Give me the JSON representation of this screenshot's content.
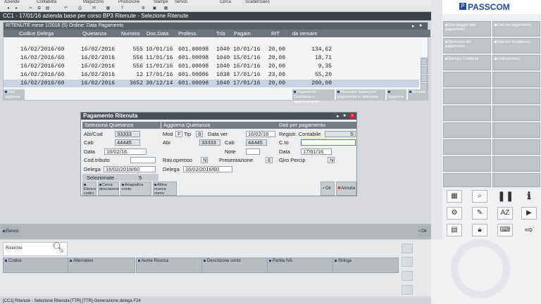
{
  "menu": {
    "items": [
      "Aziende",
      "Contabilità",
      "Magazzino",
      "Produzione",
      "Stampe",
      "Servizi",
      "Cerca",
      "Scadenziario"
    ]
  },
  "window": {
    "title": "CC1 - 17/01/16 azienda base per corso BP3  Ritenute - Selezione Ritenute"
  },
  "list": {
    "header": "RITENUTE  mese 1/2016 (5)  Ordine: Data Pagamento",
    "columns": [
      "Codice Delega",
      "Quietanza",
      "Numero",
      "Doc.Data",
      "Profess.",
      "Trib",
      "Pagam.",
      "RIT",
      "da versare"
    ],
    "rows": [
      {
        "codice": "16/02/2016/60",
        "quietanza": "16/02/2016",
        "numero": "555",
        "docdata": "10/01/16",
        "profess": "601.00098",
        "trib": "1040",
        "pagam": "10/01/16",
        "rit": "20,00",
        "versare": "134,62"
      },
      {
        "codice": "16/02/2016/60",
        "quietanza": "16/02/2016",
        "numero": "556",
        "docdata": "11/01/16",
        "profess": "601.00098",
        "trib": "1040",
        "pagam": "15/01/16",
        "rit": "20,00",
        "versare": "18,71"
      },
      {
        "codice": "16/02/2016/60",
        "quietanza": "16/02/2016",
        "numero": "556",
        "docdata": "11/01/16",
        "profess": "601.00098",
        "trib": "1040",
        "pagam": "16/01/16",
        "rit": "20,00",
        "versare": "9,35"
      },
      {
        "codice": "16/02/2016/60",
        "quietanza": "16/02/2016",
        "numero": "12",
        "docdata": "17/01/16",
        "profess": "601.00086",
        "trib": "1038",
        "pagam": "17/01/16",
        "rit": "23,00",
        "versare": "55,20"
      },
      {
        "codice": "16/02/2016/60",
        "quietanza": "16/02/2016",
        "numero": "3652",
        "docdata": "30/12/14",
        "profess": "601.00098",
        "trib": "1040",
        "pagam": "17/01/16",
        "rit": "20,00",
        "versare": "200,00"
      }
    ],
    "buttons": {
      "esci": "Esci aggiorna",
      "pagamento": "Pagamento Quietanza e aggiornamento",
      "revisione": "Revisione operazioni pagamento in selezione",
      "aggiorna": "Aggiorna",
      "annulla": "Annulla"
    }
  },
  "dialog": {
    "title": "Pagamento Ritenuta",
    "sel_header": "Seleziona Quietanza",
    "agg_header": "Aggiorna Quietanza",
    "dati_header": "Dati per pagamento",
    "abicod_label": "Abi/Cod",
    "abicod_value": "33333",
    "cab_label": "Cab",
    "cab_value": "44445",
    "data_label": "Data",
    "data_value": "16/02/16",
    "codtributo_label": "Cod.tributo",
    "delega_label": "Delega",
    "delega_value": "16/02/2016/60",
    "selezionate_label": "Selezionate",
    "selezionate_value": "5",
    "mod_label": "Mod",
    "mod_value": "F",
    "tip_label": "Tip",
    "tip_value": "B",
    "dataver_label": "Data ver",
    "dataver_value": "16/02/16",
    "abi2_label": "Abi",
    "abi2_value": "33333",
    "cab2_label": "Cab",
    "cab2_value": "44445",
    "note_label": "Note",
    "ravoperoso_label": "Rav.operoso",
    "ravoperoso_value": "N",
    "presentazione_label": "Presentazione",
    "presentazione_value": "E",
    "delega2_label": "Delega",
    "delega2_value": "16/02/2016/60",
    "registr_label": "Registr. Contabile",
    "registr_value": "S",
    "cto_label": "C.to",
    "data3_label": "Data",
    "data3_value": "17/01/16",
    "giroperc_label": "Giro Percip",
    "giroperc_value": "N",
    "btn_elenco": "Elenco codici",
    "btn_cerca": "Cerca descrizione",
    "btn_anagrafica": "Anagrafica conto",
    "btn_attiva": "Attiva ricerca menu",
    "btn_ok": "Ok",
    "btn_annulla": "Annulla"
  },
  "bottom": {
    "elenco": "Elenco",
    "ok": "Ok",
    "ricerche": "Ricerche",
    "buttons": [
      "Codice",
      "Alternativo",
      "Nome Ricerca",
      "Descrizione conto",
      "Partita IVA",
      "Stringa"
    ]
  },
  "status": {
    "left": "[CC1] Ritenute - Selezione Ritenute",
    "right": "[TTR] [TTR]-Generazione delega F24"
  },
  "right": {
    "logo": "PASSCOM",
    "buttons": [
      "Salvataggio dati pagamento",
      "Dati del pagamento",
      "Storicizza del pagamento",
      "Stampa brogliaccio",
      "Stampa Certificati",
      "Ordinamento"
    ]
  },
  "colors": {
    "accent": "#1f4b9a",
    "titlebar": "#3d4249",
    "header": "#5a6068"
  }
}
